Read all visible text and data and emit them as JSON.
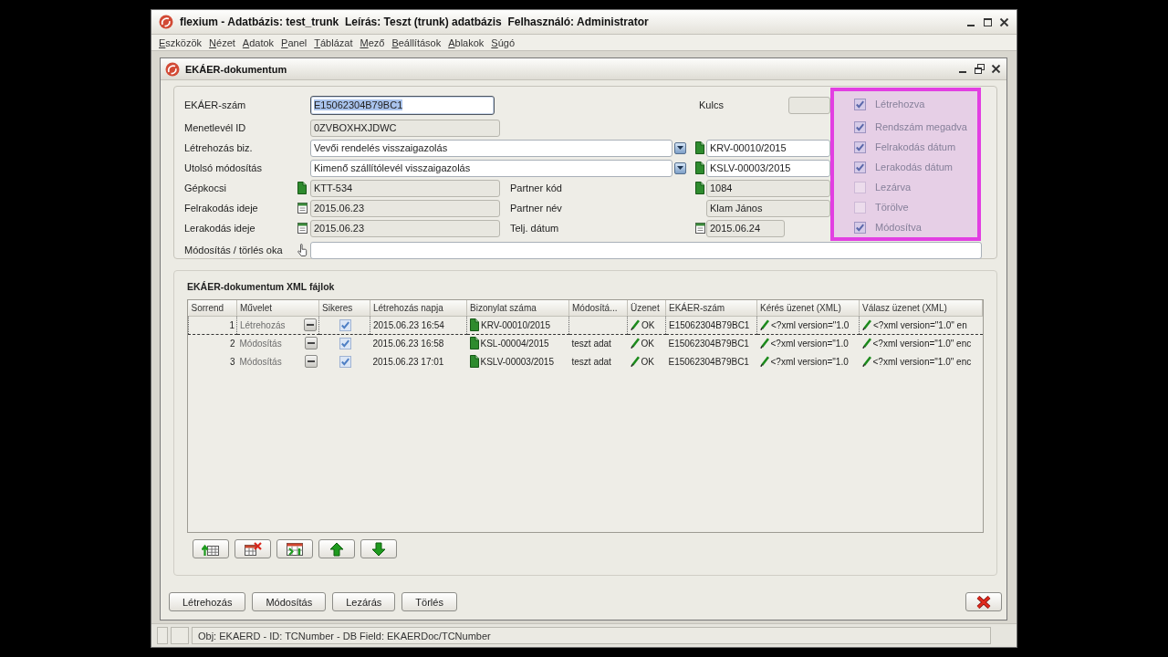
{
  "window": {
    "title": "flexium - Adatbázis: test_trunk  Leírás: Teszt (trunk) adatbázis  Felhasználó: Administrator"
  },
  "menu": [
    "Eszközök",
    "Nézet",
    "Adatok",
    "Panel",
    "Táblázat",
    "Mező",
    "Beállítások",
    "Ablakok",
    "Súgó"
  ],
  "document_window": {
    "title": "EKÁER-dokumentum",
    "form": {
      "rows": [
        {
          "left": {
            "label": "EKÁER-szám",
            "kind": "text",
            "value": "E15062304B79BC1",
            "readonly": false,
            "focused": true
          },
          "right": {
            "label": "Kulcs",
            "kind": "compact",
            "readonly": true,
            "focused": false
          }
        },
        {
          "left": {
            "label": "Menetlevél ID",
            "kind": "text",
            "value": "0ZVBOXHXJDWC",
            "readonly": true,
            "focused": false
          }
        },
        {
          "left": {
            "label": "Létrehozás biz.",
            "kind": "dropdown",
            "value": "Vevői rendelés visszaigazolás",
            "readonly": false,
            "focused": false
          },
          "right": {
            "kind": "lookup",
            "value": "KRV-00010/2015",
            "readonly": false,
            "focused": false
          }
        },
        {
          "left": {
            "label": "Utolsó módosítás",
            "kind": "dropdown",
            "value": "Kimenő szállítólevél visszaigazolás",
            "readonly": false,
            "focused": false
          },
          "right": {
            "kind": "lookup",
            "value": "KSLV-00003/2015",
            "readonly": false,
            "focused": false
          }
        },
        {
          "left": {
            "label": "Gépkocsi",
            "kind": "lookup",
            "value": "KTT-534",
            "readonly": true,
            "focused": false
          },
          "right": {
            "label": "Partner kód",
            "kind": "lookup",
            "value": "1084",
            "readonly": true,
            "focused": false
          }
        },
        {
          "left": {
            "label": "Felrakodás ideje",
            "kind": "date",
            "value": "2015.06.23",
            "readonly": true,
            "focused": false
          },
          "right": {
            "label": "Partner név",
            "kind": "text",
            "value": "Klam János",
            "readonly": true,
            "focused": false
          }
        },
        {
          "left": {
            "label": "Lerakodás ideje",
            "kind": "date",
            "value": "2015.06.23",
            "readonly": true,
            "focused": false
          },
          "right": {
            "label": "Telj. dátum",
            "kind": "date",
            "value": "2015.06.24",
            "readonly": true,
            "focused": false
          }
        }
      ],
      "reason": {
        "label": "Módosítás / törlés oka",
        "kind": "note",
        "readonly": false,
        "focused": false
      },
      "flags": {
        "highlighted": true,
        "items": [
          {
            "label": "Létrehozva",
            "checked": true
          },
          {
            "label": "Rendszám megadva",
            "checked": true
          },
          {
            "label": "Felrakodás dátum",
            "checked": true
          },
          {
            "label": "Lerakodás dátum",
            "checked": true
          },
          {
            "label": "Lezárva",
            "checked": false
          },
          {
            "label": "Törölve",
            "checked": false
          },
          {
            "label": "Módosítva",
            "checked": true
          }
        ]
      }
    },
    "xml_files": {
      "title": "EKÁER-dokumentum XML fájlok",
      "columns": [
        "Sorrend",
        "Művelet",
        "Sikeres",
        "Létrehozás napja",
        "Bizonylat száma",
        "Módosítá...",
        "Üzenet",
        "EKÁER-szám",
        "Kérés üzenet (XML)",
        "Válasz üzenet (XML)"
      ],
      "rows": [
        {
          "selected": true,
          "order": "1",
          "operation": "Létrehozás",
          "successful": true,
          "created": "2015.06.23 16:54",
          "document_number": "KRV-00010/2015",
          "message": "OK",
          "ekaer_number": "E15062304B79BC1",
          "request_xml": "<?xml version=\"1.0",
          "response_xml": "<?xml version=\"1.0\" en"
        },
        {
          "selected": false,
          "order": "2",
          "operation": "Módosítás",
          "successful": true,
          "created": "2015.06.23 16:58",
          "document_number": "KSL-00004/2015",
          "modification": "teszt adat",
          "message": "OK",
          "ekaer_number": "E15062304B79BC1",
          "request_xml": "<?xml version=\"1.0",
          "response_xml": "<?xml version=\"1.0\" enc"
        },
        {
          "selected": false,
          "order": "3",
          "operation": "Módosítás",
          "successful": true,
          "created": "2015.06.23 17:01",
          "document_number": "KSLV-00003/2015",
          "modification": "teszt adat",
          "message": "OK",
          "ekaer_number": "E15062304B79BC1",
          "request_xml": "<?xml version=\"1.0",
          "response_xml": "<?xml version=\"1.0\" enc"
        }
      ]
    },
    "buttons": [
      "Létrehozás",
      "Módosítás",
      "Lezárás",
      "Törlés"
    ]
  },
  "status_bar": {
    "text": "Obj: EKAERD - ID: TCNumber - DB Field: EKAERDoc/TCNumber"
  }
}
